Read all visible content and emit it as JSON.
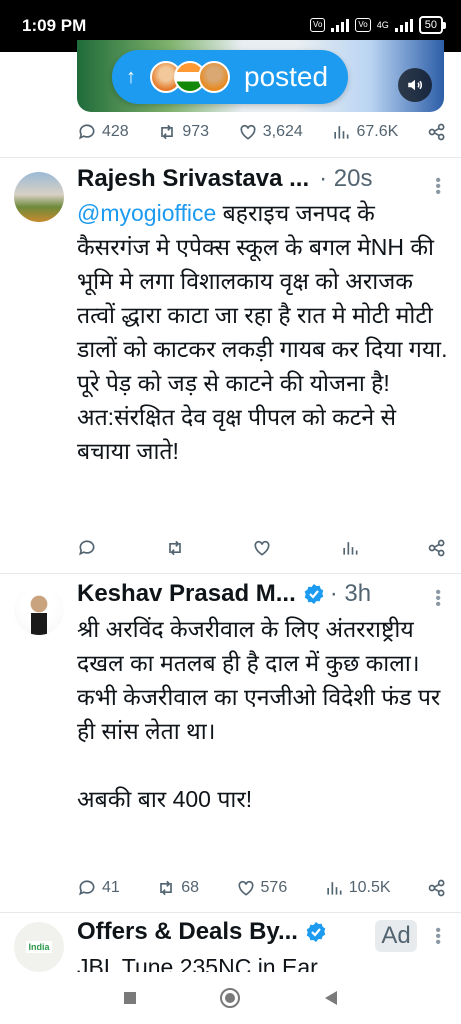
{
  "status_bar": {
    "time": "1:09 PM",
    "network": "4G",
    "battery": "50"
  },
  "top_post": {
    "pill_label": "posted",
    "stats": {
      "replies": "428",
      "reposts": "973",
      "likes": "3,624",
      "views": "67.6K"
    }
  },
  "tweets": [
    {
      "name": "Rajesh Srivastava ...",
      "time": "· 20s",
      "mention": "@myogioffice",
      "text_1": " बहराइच जनपद के कैसरगंज मे एपेक्स स्कूल के बगल मेNH की भूमि मे लगा विशालकाय वृक्ष को अराजक तत्वों द्धारा काटा जा रहा है रात मे मोटी मोटी डालों को काटकर लकड़ी गायब कर दिया गया. पूरे पेड़ को जड़ से काटने की योजना है!",
      "text_2": "अत:संरक्षित देव वृक्ष पीपल को कटने से बचाया जाते!"
    },
    {
      "name": "Keshav Prasad M...",
      "time": "· 3h",
      "text_1": "श्री अरविंद केजरीवाल के लिए अंतरराष्ट्रीय दखल का मतलब ही है दाल में कुछ काला। कभी केजरीवाल का एनजीओ विदेशी फंड पर ही सांस लेता था।",
      "text_2": "अबकी बार 400 पार!",
      "stats": {
        "replies": "41",
        "reposts": "68",
        "likes": "576",
        "views": "10.5K"
      }
    },
    {
      "name": "Offers & Deals By...",
      "ad_label": "Ad",
      "avatar_text": "India",
      "text_1": "JBL Tune 235NC in Ear"
    }
  ],
  "colors": {
    "accent": "#1d9bf0",
    "text": "#0f1419",
    "muted": "#536471"
  }
}
